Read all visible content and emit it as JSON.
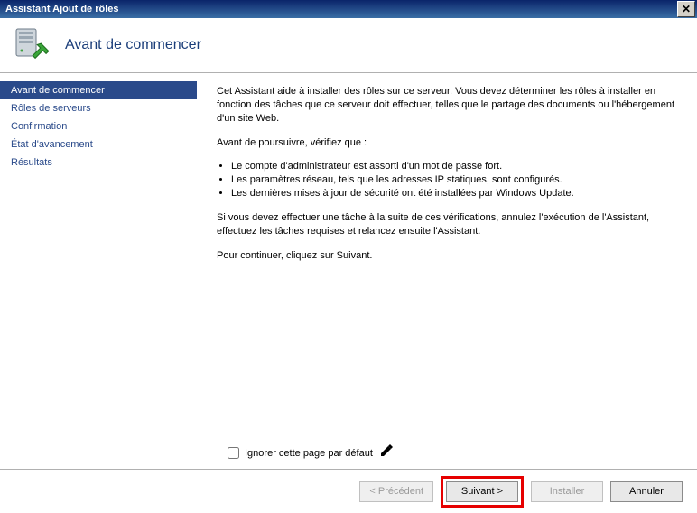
{
  "titlebar": {
    "text": "Assistant Ajout de rôles"
  },
  "header": {
    "title": "Avant de commencer"
  },
  "nav": {
    "items": [
      {
        "label": "Avant de commencer",
        "selected": true
      },
      {
        "label": "Rôles de serveurs",
        "selected": false
      },
      {
        "label": "Confirmation",
        "selected": false
      },
      {
        "label": "État d'avancement",
        "selected": false
      },
      {
        "label": "Résultats",
        "selected": false
      }
    ]
  },
  "content": {
    "intro": "Cet Assistant aide à installer des rôles sur ce serveur. Vous devez déterminer les rôles à installer en fonction des tâches que ce serveur doit effectuer, telles que le partage des documents ou l'hébergement d'un site Web.",
    "verify_heading": "Avant de poursuivre, vérifiez que :",
    "bullets": [
      "Le compte d'administrateur est assorti d'un mot de passe fort.",
      "Les paramètres réseau, tels que les adresses IP statiques, sont configurés.",
      "Les dernières mises à jour de sécurité ont été installées par Windows Update."
    ],
    "cancel_hint": "Si vous devez effectuer une tâche à la suite de ces vérifications, annulez l'exécution de l'Assistant, effectuez les tâches requises et relancez ensuite l'Assistant.",
    "continue_hint": "Pour continuer, cliquez sur Suivant."
  },
  "skip": {
    "label": "Ignorer cette page par défaut",
    "checked": false
  },
  "buttons": {
    "prev": "< Précédent",
    "next": "Suivant >",
    "install": "Installer",
    "cancel": "Annuler"
  }
}
